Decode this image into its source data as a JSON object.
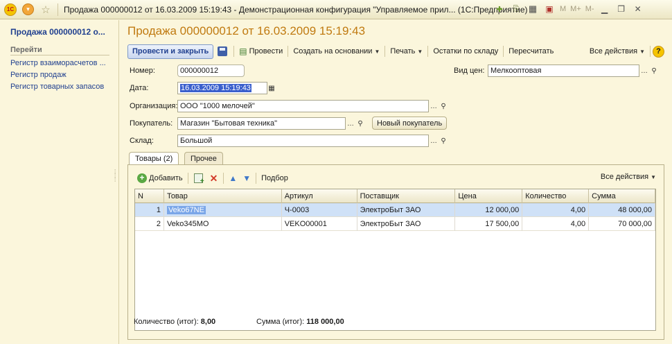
{
  "window": {
    "logo_text": "1С",
    "title": "Продажа 000000012 от 16.03.2009 15:19:43 - Демонстрационная конфигурация \"Управляемое прил... (1С:Предприятие)",
    "m_buttons": [
      "M",
      "M+",
      "M-"
    ]
  },
  "left_panel": {
    "title": "Продажа 000000012 о...",
    "section": "Перейти",
    "links": [
      "Регистр взаиморасчетов ...",
      "Регистр продаж",
      "Регистр товарных запасов"
    ]
  },
  "form": {
    "title": "Продажа 000000012 от 16.03.2009 15:19:43",
    "toolbar": {
      "post_close": "Провести и закрыть",
      "post": "Провести",
      "create_based": "Создать на основании",
      "print": "Печать",
      "stock_balance": "Остатки по складу",
      "recalc": "Пересчитать",
      "all_actions": "Все действия",
      "help": "?"
    },
    "fields": {
      "number_label": "Номер:",
      "number_value": "000000012",
      "date_label": "Дата:",
      "date_value": "16.03.2009 15:19:43",
      "org_label": "Организация:",
      "org_value": "ООО \"1000 мелочей\"",
      "buyer_label": "Покупатель:",
      "buyer_value": "Магазин \"Бытовая техника\"",
      "new_buyer_button": "Новый покупатель",
      "warehouse_label": "Склад:",
      "warehouse_value": "Большой",
      "price_type_label": "Вид цен:",
      "price_type_value": "Мелкооптовая"
    },
    "tabs": [
      "Товары (2)",
      "Прочее"
    ],
    "goods": {
      "add": "Добавить",
      "pick": "Подбор",
      "all_actions": "Все действия",
      "columns": [
        "N",
        "Товар",
        "Артикул",
        "Поставщик",
        "Цена",
        "Количество",
        "Сумма"
      ],
      "rows": [
        {
          "n": "1",
          "item": "Veko67NE",
          "article": "Ч-0003",
          "supplier": "ЭлектроБыт ЗАО",
          "price": "12 000,00",
          "qty": "4,00",
          "sum": "48 000,00"
        },
        {
          "n": "2",
          "item": "Veko345MO",
          "article": "VEKO00001",
          "supplier": "ЭлектроБыт ЗАО",
          "price": "17 500,00",
          "qty": "4,00",
          "sum": "70 000,00"
        }
      ]
    },
    "totals": {
      "qty_label": "Количество (итог):",
      "qty_value": "8,00",
      "sum_label": "Сумма (итог):",
      "sum_value": "118 000,00"
    }
  },
  "colors": {
    "background": "#fbf6dc",
    "title_accent": "#c07a10",
    "link": "#1f3f8f",
    "selected_row": "#cfe1f7"
  }
}
